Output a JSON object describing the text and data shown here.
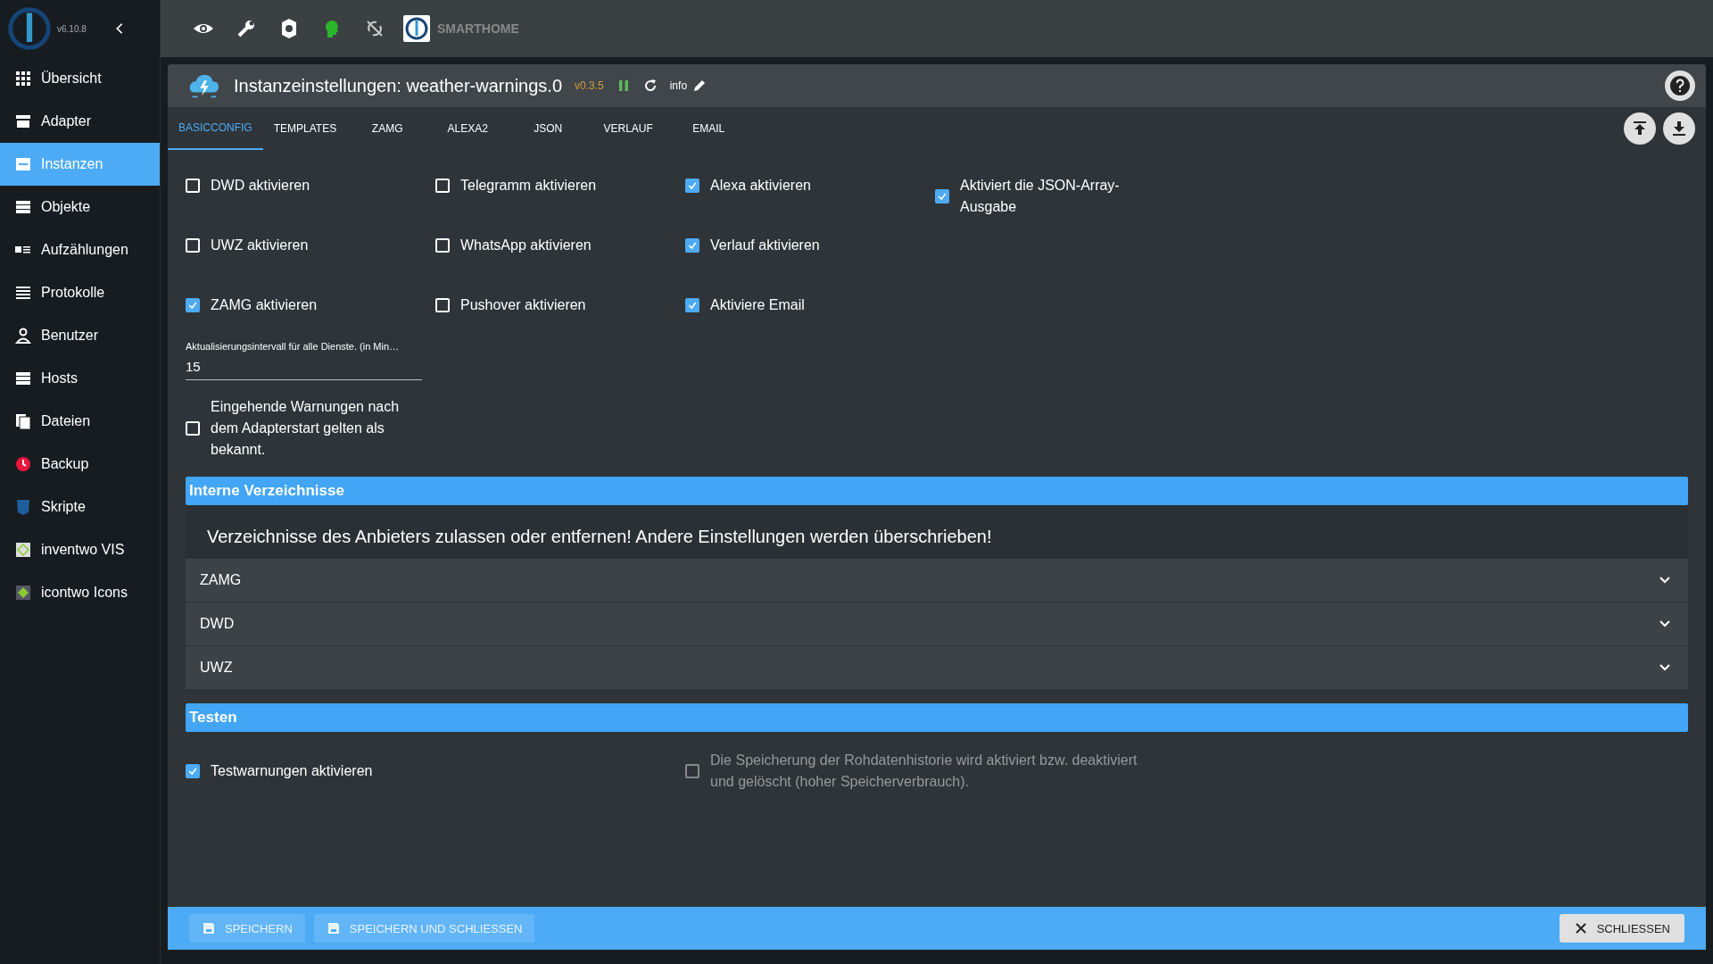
{
  "sidebar": {
    "version": "v6.10.8",
    "items": [
      {
        "label": "Übersicht",
        "selected": false
      },
      {
        "label": "Adapter",
        "selected": false
      },
      {
        "label": "Instanzen",
        "selected": true
      },
      {
        "label": "Objekte",
        "selected": false
      },
      {
        "label": "Aufzählungen",
        "selected": false
      },
      {
        "label": "Protokolle",
        "selected": false
      },
      {
        "label": "Benutzer",
        "selected": false
      },
      {
        "label": "Hosts",
        "selected": false
      },
      {
        "label": "Dateien",
        "selected": false
      },
      {
        "label": "Backup",
        "selected": false
      },
      {
        "label": "Skripte",
        "selected": false
      },
      {
        "label": "inventwo VIS",
        "selected": false
      },
      {
        "label": "icontwo Icons",
        "selected": false
      }
    ]
  },
  "toolbar": {
    "brand": "SMARTHOME"
  },
  "dialog": {
    "title": "Instanzeinstellungen: weather-warnings.0",
    "version": "v0.3.5",
    "info": "info"
  },
  "tabs": [
    {
      "label": "BASICCONFIG",
      "selected": true
    },
    {
      "label": "TEMPLATES",
      "selected": false
    },
    {
      "label": "ZAMG",
      "selected": false
    },
    {
      "label": "ALEXA2",
      "selected": false
    },
    {
      "label": "JSON",
      "selected": false
    },
    {
      "label": "VERLAUF",
      "selected": false
    },
    {
      "label": "EMAIL",
      "selected": false
    }
  ],
  "option_columns": [
    {
      "items": [
        {
          "label": "DWD aktivieren",
          "checked": false
        },
        {
          "label": "UWZ aktivieren",
          "checked": false
        },
        {
          "label": "ZAMG aktivieren",
          "checked": true
        }
      ]
    },
    {
      "items": [
        {
          "label": "Telegramm aktivieren",
          "checked": false
        },
        {
          "label": "WhatsApp aktivieren",
          "checked": false
        },
        {
          "label": "Pushover aktivieren",
          "checked": false
        }
      ]
    },
    {
      "items": [
        {
          "label": "Alexa aktivieren",
          "checked": true
        },
        {
          "label": "Verlauf aktivieren",
          "checked": true
        },
        {
          "label": "Aktiviere Email",
          "checked": true
        }
      ]
    },
    {
      "items": [
        {
          "label": "Aktiviert die JSON-Array-Ausgabe",
          "checked": true
        }
      ]
    }
  ],
  "interval_field": {
    "label": "Aktualisierungsintervall für alle Dienste. (in Min…",
    "value": "15"
  },
  "known_warnings": {
    "label": "Eingehende Warnungen nach dem Adapterstart gelten als bekannt.",
    "checked": false
  },
  "directories": {
    "header": "Interne Verzeichnisse",
    "text": "Verzeichnisse des Anbieters zulassen oder entfernen! Andere Einstellungen werden überschrieben!",
    "panels": [
      {
        "label": "ZAMG",
        "expanded": false
      },
      {
        "label": "DWD",
        "expanded": false
      },
      {
        "label": "UWZ",
        "expanded": false
      }
    ]
  },
  "testing": {
    "header": "Testen",
    "options": [
      {
        "label": "Testwarnungen aktivieren",
        "checked": true,
        "disabled": false
      },
      {
        "label": "Die Speicherung der Rohdatenhistorie wird aktiviert bzw. deaktiviert und gelöscht (hoher Speicherverbrauch).",
        "checked": false,
        "disabled": true
      }
    ]
  },
  "footer": {
    "save": "SPEICHERN",
    "save_close": "SPEICHERN UND SCHLIESSEN",
    "close": "SCHLIESSEN"
  }
}
